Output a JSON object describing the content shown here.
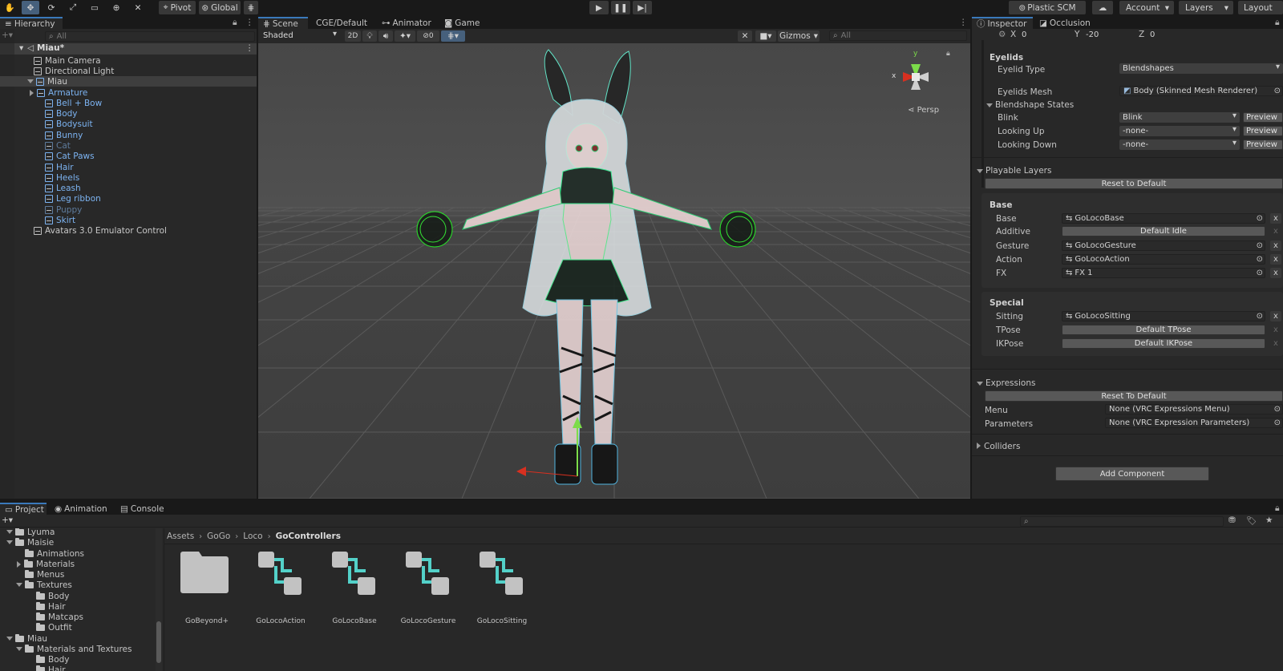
{
  "toolbar": {
    "pivot": "Pivot",
    "global": "Global",
    "plastic_scm": "Plastic SCM",
    "account": "Account",
    "layers": "Layers",
    "layout": "Layout"
  },
  "hierarchy": {
    "tab": "Hierarchy",
    "search_placeholder": "All",
    "scene": "Miau*",
    "items": [
      {
        "label": "Main Camera"
      },
      {
        "label": "Directional Light"
      },
      {
        "label": "Miau"
      },
      {
        "label": "Armature"
      },
      {
        "label": "Bell + Bow"
      },
      {
        "label": "Body"
      },
      {
        "label": "Bodysuit"
      },
      {
        "label": "Bunny"
      },
      {
        "label": "Cat"
      },
      {
        "label": "Cat Paws"
      },
      {
        "label": "Hair"
      },
      {
        "label": "Heels"
      },
      {
        "label": "Leash"
      },
      {
        "label": "Leg ribbon"
      },
      {
        "label": "Puppy"
      },
      {
        "label": "Skirt"
      },
      {
        "label": "Avatars 3.0 Emulator Control"
      }
    ]
  },
  "scene": {
    "tabs": [
      "Scene",
      "CGE/Default",
      "Animator",
      "Game"
    ],
    "shading": "Shaded",
    "mode_2d": "2D",
    "hidden_count": "0",
    "gizmos": "Gizmos",
    "search_placeholder": "All",
    "persp": "Persp",
    "axis_x": "x",
    "axis_y": "y"
  },
  "inspector": {
    "tabs": [
      "Inspector",
      "Occlusion"
    ],
    "pos": {
      "x_label": "X",
      "x": "0",
      "y_label": "Y",
      "y": "-20",
      "z_label": "Z",
      "z": "0"
    },
    "eyelids": {
      "header": "Eyelids",
      "type_label": "Eyelid Type",
      "type_value": "Blendshapes",
      "mesh_label": "Eyelids Mesh",
      "mesh_value": "Body (Skinned Mesh Renderer)",
      "states_label": "Blendshape States",
      "states": [
        {
          "label": "Blink",
          "value": "Blink",
          "preview": "Preview"
        },
        {
          "label": "Looking Up",
          "value": "-none-",
          "preview": "Preview"
        },
        {
          "label": "Looking Down",
          "value": "-none-",
          "preview": "Preview"
        }
      ]
    },
    "playable": {
      "header": "Playable Layers",
      "reset": "Reset to Default",
      "base_header": "Base",
      "base": [
        {
          "label": "Base",
          "value": "GoLocoBase",
          "kind": "asset"
        },
        {
          "label": "Additive",
          "value": "Default Idle",
          "kind": "button"
        },
        {
          "label": "Gesture",
          "value": "GoLocoGesture",
          "kind": "asset"
        },
        {
          "label": "Action",
          "value": "GoLocoAction",
          "kind": "asset"
        },
        {
          "label": "FX",
          "value": "FX 1",
          "kind": "asset"
        }
      ],
      "special_header": "Special",
      "special": [
        {
          "label": "Sitting",
          "value": "GoLocoSitting",
          "kind": "asset"
        },
        {
          "label": "TPose",
          "value": "Default TPose",
          "kind": "button"
        },
        {
          "label": "IKPose",
          "value": "Default IKPose",
          "kind": "button"
        }
      ],
      "x": "x"
    },
    "expressions": {
      "header": "Expressions",
      "reset": "Reset To Default",
      "menu_label": "Menu",
      "menu_value": "None (VRC Expressions Menu)",
      "params_label": "Parameters",
      "params_value": "None (VRC Expression Parameters)"
    },
    "colliders": "Colliders",
    "add_component": "Add Component"
  },
  "project": {
    "tabs": [
      "Project",
      "Animation",
      "Console"
    ],
    "breadcrumb": [
      "Assets",
      "GoGo",
      "Loco",
      "GoControllers"
    ],
    "tree": [
      {
        "label": "Lyuma",
        "depth": 1,
        "arrow": "open"
      },
      {
        "label": "Maisie",
        "depth": 1,
        "arrow": "open"
      },
      {
        "label": "Animations",
        "depth": 2,
        "arrow": "none"
      },
      {
        "label": "Materials",
        "depth": 2,
        "arrow": "closed"
      },
      {
        "label": "Menus",
        "depth": 2,
        "arrow": "none"
      },
      {
        "label": "Textures",
        "depth": 2,
        "arrow": "open"
      },
      {
        "label": "Body",
        "depth": 3,
        "arrow": "none"
      },
      {
        "label": "Hair",
        "depth": 3,
        "arrow": "none"
      },
      {
        "label": "Matcaps",
        "depth": 3,
        "arrow": "none"
      },
      {
        "label": "Outfit",
        "depth": 3,
        "arrow": "none"
      },
      {
        "label": "Miau",
        "depth": 1,
        "arrow": "open"
      },
      {
        "label": "Materials and Textures",
        "depth": 2,
        "arrow": "open"
      },
      {
        "label": "Body",
        "depth": 3,
        "arrow": "none"
      },
      {
        "label": "Hair",
        "depth": 3,
        "arrow": "none"
      }
    ],
    "assets": [
      {
        "name": "GoBeyond+",
        "icon": "folder-icon"
      },
      {
        "name": "GoLocoAction",
        "icon": "animator-controller-icon"
      },
      {
        "name": "GoLocoBase",
        "icon": "animator-controller-icon"
      },
      {
        "name": "GoLocoGesture",
        "icon": "animator-controller-icon"
      },
      {
        "name": "GoLocoSitting",
        "icon": "animator-controller-icon"
      }
    ]
  },
  "colors": {
    "accent": "#3a79bb",
    "selection": "#2c5d87",
    "panel": "#282828",
    "viewport": "#464646",
    "link_text": "#7cb3f1",
    "disabled_text": "#5e7b9c",
    "toolbar_active": "#46607c"
  }
}
